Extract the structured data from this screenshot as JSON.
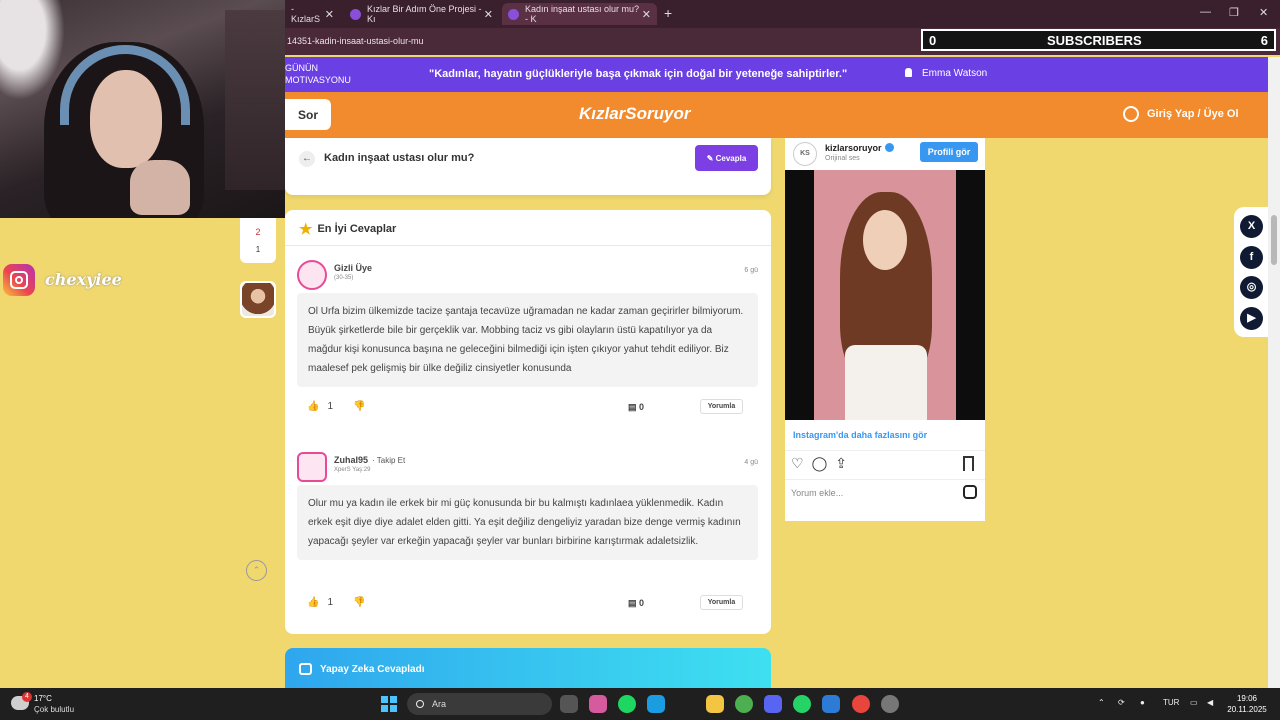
{
  "browser": {
    "tabs": [
      {
        "label": "- KızlarS"
      },
      {
        "label": "Kızlar Bir Adım Öne Projesi - Kı"
      },
      {
        "label": "Kadın inşaat ustası olur mu? - K"
      }
    ],
    "url": "14351-kadin-insaat-ustasi-olur-mu"
  },
  "subscriber_overlay": {
    "left_count": "0",
    "label": "SUBSCRIBERS",
    "right_count": "6"
  },
  "motivation": {
    "label_line1": "GÜNÜN",
    "label_line2": "MOTIVASYONU",
    "quote": "\"Kadınlar, hayatın güçlükleriyle başa çıkmak için doğal bir yeteneğe sahiptirler.\"",
    "author": "Emma Watson"
  },
  "header": {
    "ask_label": "Sor",
    "logo": "KızlarSoruyor",
    "login_label": "Giriş Yap / Üye Ol"
  },
  "question": {
    "title": "Kadın inşaat ustası olur mu?",
    "answer_button": "Cevapla"
  },
  "best_answers": {
    "title": "En İyi Cevaplar",
    "answers": [
      {
        "username": "Gizli Üye",
        "age": "(30-35)",
        "time": "6 gü",
        "body": "Ol Urfa bizim ülkemizde tacize şantaja tecavüze uğramadan ne kadar zaman geçirirler bilmiyorum. Büyük şirketlerde bile bir gerçeklik var. Mobbing taciz vs gibi olayların üstü kapatılıyor ya da mağdur kişi konusunca başına ne geleceğini bilmediği için işten çıkıyor yahut tehdit ediliyor. Biz maalesef pek gelişmiş bir ülke değiliz cinsiyetler konusunda",
        "likes": "1",
        "comments": "0",
        "reply_label": "Yorumla"
      },
      {
        "username": "Zuhal95",
        "follow": "· Takip Et",
        "age": "XperS Yaş:29",
        "time": "4 gü",
        "body": "Olur mu ya kadın ile erkek bir mi güç konusunda bir bu kalmıştı kadınlaea yüklenmedik. Kadın erkek eşit diye diye adalet elden gitti. Ya eşit değiliz dengeliyiz yaradan bize denge vermiş kadının yapacağı şeyler var erkeğin yapacağı şeyler var bunları birbirine karıştırmak adaletsizlik.",
        "likes": "1",
        "comments": "0",
        "reply_label": "Yorumla"
      }
    ]
  },
  "ai_answers": {
    "title": "Yapay Zeka Cevapladı"
  },
  "left_rail": {
    "vote_red": "2",
    "vote_count": "1"
  },
  "stream": {
    "instagram_handle": "chexyiee"
  },
  "instagram_embed": {
    "username": "kizlarsoruyor",
    "logo_text": "KS",
    "sound": "Orijinal ses",
    "profile_button": "Profili gör",
    "more_link": "Instagram'da daha fazlasını gör",
    "comment_placeholder": "Yorum ekle..."
  },
  "share": {
    "icons": [
      "x-icon",
      "facebook-icon",
      "instagram-icon",
      "youtube-icon"
    ]
  },
  "taskbar": {
    "temperature": "17°C",
    "condition": "Çok bulutlu",
    "weather_badge": "4",
    "search_label": "Ara",
    "language": "TUR",
    "time": "19:06",
    "date": "20.11.2025"
  },
  "colors": {
    "brand_orange": "#f28b2d",
    "brand_purple": "#6a3fe4",
    "page_yellow": "#f0d86e"
  }
}
